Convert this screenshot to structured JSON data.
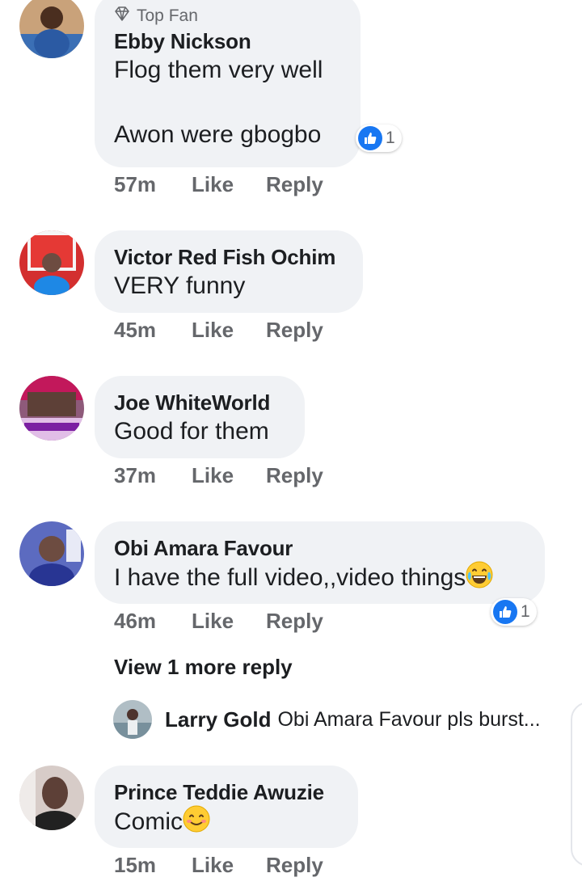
{
  "comments": [
    {
      "badge_label": "Top Fan",
      "badge_icon": "diamond-icon",
      "name": "Ebby Nickson",
      "text": "Flog them very well\n\nAwon were gbogbo",
      "time": "57m",
      "like_label": "Like",
      "reply_label": "Reply",
      "reaction_count": "1"
    },
    {
      "name": "Victor Red Fish Ochim",
      "text": "VERY funny",
      "time": "45m",
      "like_label": "Like",
      "reply_label": "Reply"
    },
    {
      "name": "Joe WhiteWorld",
      "text": "Good for them",
      "time": "37m",
      "like_label": "Like",
      "reply_label": "Reply"
    },
    {
      "name": "Obi Amara Favour",
      "text": "I have the full video,,video things",
      "emoji": "face-with-tears-of-joy-emoji",
      "time": "46m",
      "like_label": "Like",
      "reply_label": "Reply",
      "reaction_count": "1",
      "view_more_label": "View 1 more reply",
      "reply_preview": {
        "name": "Larry Gold",
        "text": "Obi Amara Favour pls burst..."
      }
    },
    {
      "name": "Prince Teddie Awuzie",
      "text": "Comic",
      "emoji": "smiling-face-emoji",
      "time": "15m",
      "like_label": "Like",
      "reply_label": "Reply"
    }
  ],
  "colors": {
    "bubble": "#f0f2f5",
    "like_blue": "#1877f2",
    "meta_gray": "#65676b",
    "text": "#1c1e21"
  }
}
